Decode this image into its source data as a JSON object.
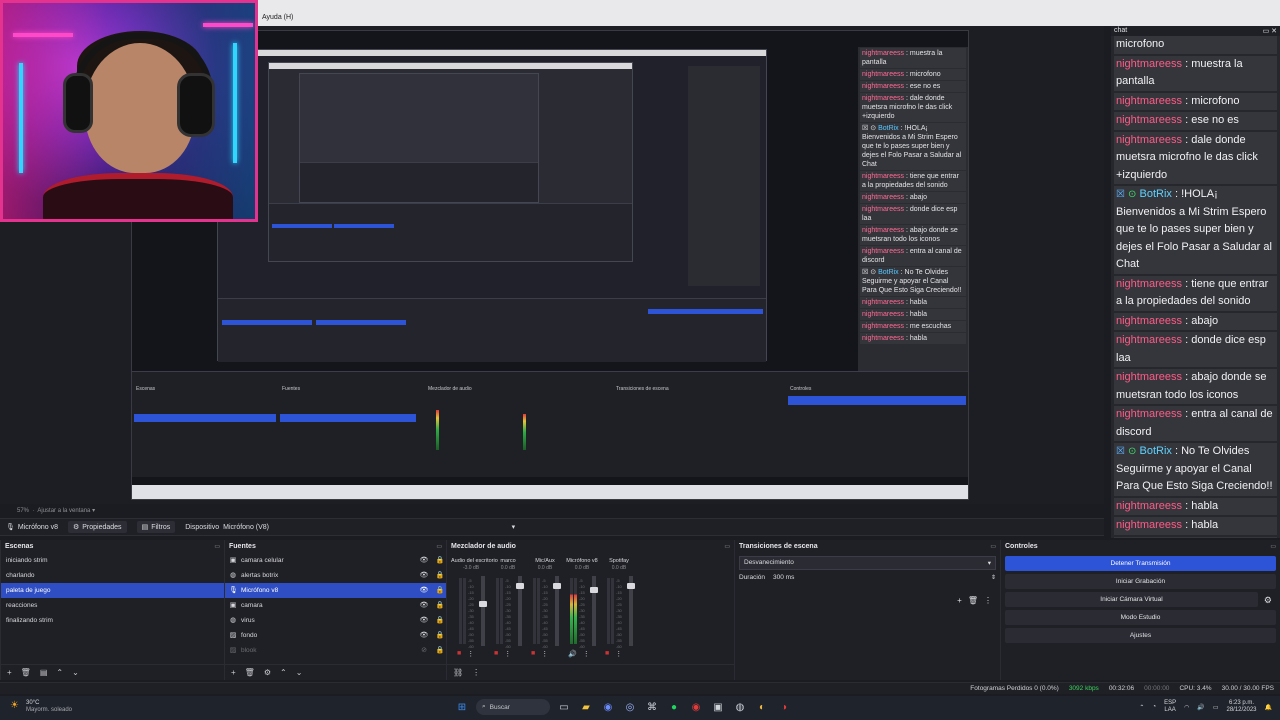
{
  "menu": {
    "help": "Ayuda (H)"
  },
  "preview": {
    "zoom_label": "57%",
    "fit_label": "Ajustar a la ventana",
    "nested_chat": [
      {
        "user": "nightmareess",
        "text": ": muestra la pantalla"
      },
      {
        "user": "nightmareess",
        "text": ": microfono"
      },
      {
        "user": "nightmareess",
        "text": ": ese no es"
      },
      {
        "user": "nightmareess",
        "text": ": dale donde muetsra microfno le das click +izquierdo"
      },
      {
        "user": "BotRix",
        "text": ": !HOLA¡ Bienvenidos a Mi Strim Espero que te lo pases super bien y dejes el Folo Pasar a Saludar al Chat",
        "bot": true
      },
      {
        "user": "nightmareess",
        "text": ": tiene que entrar a la propiedades del sonido"
      },
      {
        "user": "nightmareess",
        "text": ": abajo"
      },
      {
        "user": "nightmareess",
        "text": ": donde dice esp laa"
      },
      {
        "user": "nightmareess",
        "text": ": abajo donde se muetsran todo los iconos"
      },
      {
        "user": "nightmareess",
        "text": ": entra al canal de discord"
      },
      {
        "user": "BotRix",
        "text": ": No Te Olvides Seguirme y apoyar el Canal Para Que Esto Siga Creciendo!!",
        "bot": true
      },
      {
        "user": "nightmareess",
        "text": ": habla"
      },
      {
        "user": "nightmareess",
        "text": ": habla"
      },
      {
        "user": "nightmareess",
        "text": ": me escuchas"
      },
      {
        "user": "nightmareess",
        "text": ": habla"
      }
    ]
  },
  "context_bar": {
    "source_name": "Micrófono v8",
    "properties": "Propiedades",
    "filters": "Filtros",
    "device_label": "Dispositivo",
    "device_value": "Micrófono (V8)"
  },
  "scenes": {
    "title": "Escenas",
    "items": [
      "iniciando strim",
      "charlando",
      "paleta de juego",
      "reacciones",
      "finalizando strim"
    ],
    "selected": 2
  },
  "sources": {
    "title": "Fuentes",
    "items": [
      {
        "name": "camara celular",
        "icon": "camera"
      },
      {
        "name": "alertas botrix",
        "icon": "browser"
      },
      {
        "name": "Micrófono v8",
        "icon": "mic",
        "selected": true
      },
      {
        "name": "camara",
        "icon": "camera"
      },
      {
        "name": "virus",
        "icon": "browser"
      },
      {
        "name": "fondo",
        "icon": "image"
      },
      {
        "name": "blook",
        "icon": "image",
        "hidden": true
      }
    ]
  },
  "mixer": {
    "title": "Mezclador de audio",
    "channels": [
      {
        "name": "Audio del escritorio",
        "db": "-3.0 dB",
        "active": false,
        "level": 0.35
      },
      {
        "name": "marco",
        "db": "0.0 dB",
        "active": false,
        "level": 0.1
      },
      {
        "name": "Mic/Aux",
        "db": "0.0 dB",
        "active": false,
        "level": 0.1
      },
      {
        "name": "Micrófono v8",
        "db": "0.0 dB",
        "active": true,
        "level": 0.15
      },
      {
        "name": "Spotifay",
        "db": "0.0 dB",
        "active": false,
        "level": 0.1
      }
    ],
    "scale": [
      "-5",
      "-10",
      "-15",
      "-20",
      "-25",
      "-30",
      "-35",
      "-40",
      "-45",
      "-50",
      "-55",
      "-60"
    ]
  },
  "transitions": {
    "title": "Transiciones de escena",
    "selected": "Desvanecimiento",
    "duration_label": "Duración",
    "duration_value": "300 ms"
  },
  "controls": {
    "title": "Controles",
    "buttons": [
      "Detener Transmisión",
      "Iniciar Grabación",
      "Iniciar Cámara Virtual",
      "Modo Estudio",
      "Ajustes"
    ]
  },
  "status": {
    "frames_lost": "Fotogramas Perdidos 0 (0.0%)",
    "bitrate": "3092 kbps",
    "stream_time": "00:32:06",
    "rec_time": "00:00:00",
    "cpu": "CPU: 3.4%",
    "fps": "30.00 / 30.00 FPS"
  },
  "taskbar": {
    "temp": "30°C",
    "weather": "Mayorm. soleado",
    "search": "Buscar",
    "lang1": "ESP",
    "lang2": "LAA",
    "time": "6:23 p.m.",
    "date": "28/12/2023"
  },
  "chat": {
    "title": "chat",
    "messages": [
      {
        "user": "",
        "text": "microfono",
        "cut": true
      },
      {
        "user": "nightmareess",
        "text": ": muestra la pantalla"
      },
      {
        "user": "nightmareess",
        "text": ": microfono"
      },
      {
        "user": "nightmareess",
        "text": ": ese no es"
      },
      {
        "user": "nightmareess",
        "text": ": dale donde muetsra microfno le das click +izquierdo"
      },
      {
        "user": "BotRix",
        "text": ": !HOLA¡ Bienvenidos a Mi Strim Espero que te lo pases super bien y dejes el Folo Pasar a Saludar al Chat",
        "bot": true
      },
      {
        "user": "nightmareess",
        "text": ": tiene que entrar a la propiedades del sonido"
      },
      {
        "user": "nightmareess",
        "text": ": abajo"
      },
      {
        "user": "nightmareess",
        "text": ": donde dice esp laa"
      },
      {
        "user": "nightmareess",
        "text": ": abajo donde se muetsran todo los iconos"
      },
      {
        "user": "nightmareess",
        "text": ": entra al canal de discord"
      },
      {
        "user": "BotRix",
        "text": ": No Te Olvides Seguirme y apoyar el Canal Para Que Esto Siga Creciendo!!",
        "bot": true
      },
      {
        "user": "nightmareess",
        "text": ": habla"
      },
      {
        "user": "nightmareess",
        "text": ": habla"
      },
      {
        "user": "nightmareess",
        "text": ": me escuchas"
      },
      {
        "user": "nightmareess",
        "text": ": habla"
      }
    ]
  },
  "colors": {
    "accent": "#2d54d6",
    "username": "#ff5b86",
    "bot": "#5fd3ff",
    "webcam_border": "#e4338f"
  }
}
